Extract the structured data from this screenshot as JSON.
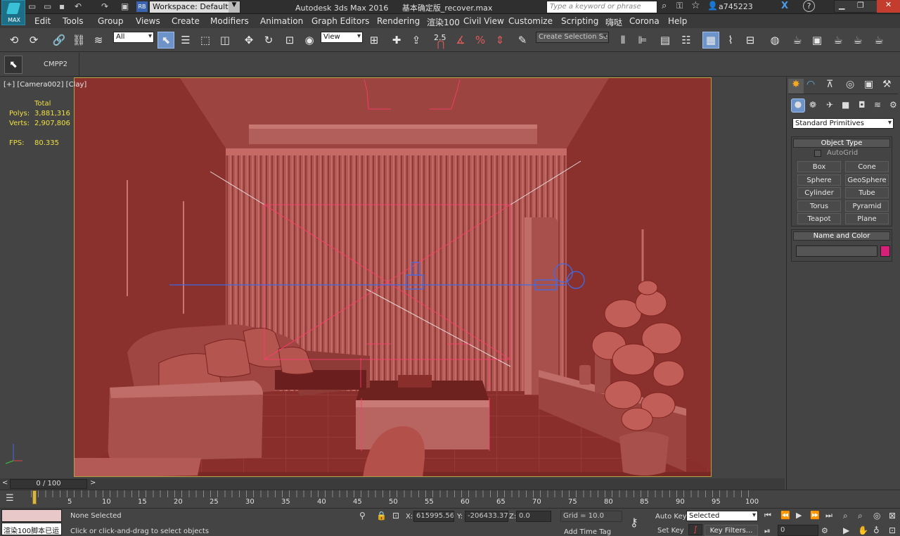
{
  "titlebar": {
    "logo_label": "MAX",
    "workspace_badge": "RB",
    "workspace": "Workspace: Default",
    "app_title": "Autodesk 3ds Max 2016",
    "file_name": "基本确定版_recover.max",
    "search_placeholder": "Type a keyword or phrase",
    "user": "a745223"
  },
  "menubar": {
    "items": [
      "Edit",
      "Tools",
      "Group",
      "Views",
      "Create",
      "Modifiers",
      "Animation",
      "Graph Editors",
      "Rendering",
      "渲染100",
      "Civil View",
      "Customize",
      "Scripting",
      "嗨哒",
      "Corona",
      "Help"
    ]
  },
  "toolbar": {
    "filter": "All",
    "reference_coord": "View",
    "snap_value": "2.5",
    "selection_set_placeholder": "Create Selection Se"
  },
  "ribbon": {
    "tab": "CMPP2"
  },
  "viewport": {
    "label": "[+] [Camera002] [Clay]",
    "stats": {
      "total_label": "Total",
      "polys_label": "Polys:",
      "polys_value": "3,881,316",
      "verts_label": "Verts:",
      "verts_value": "2,907,806",
      "fps_label": "FPS:",
      "fps_value": "80.335"
    },
    "colors": {
      "clay": "#a54844",
      "frame": "#b8a040",
      "selection": "#f05080"
    }
  },
  "command_panel": {
    "category": "Standard Primitives",
    "object_type_header": "Object Type",
    "autogrid": "AutoGrid",
    "primitives": [
      "Box",
      "Cone",
      "Sphere",
      "GeoSphere",
      "Cylinder",
      "Tube",
      "Torus",
      "Pyramid",
      "Teapot",
      "Plane"
    ],
    "name_color_header": "Name and Color",
    "object_color": "#d8207a"
  },
  "timeline": {
    "frame_label": "0 / 100",
    "ticks": [
      "5",
      "10",
      "15",
      "20",
      "25",
      "30",
      "35",
      "40",
      "45",
      "50",
      "55",
      "60",
      "65",
      "70",
      "75",
      "80",
      "85",
      "90",
      "95",
      "100"
    ]
  },
  "status": {
    "maxscript_text": "渲染100脚本已运",
    "selection": "None Selected",
    "prompt": "Click or click-and-drag to select objects",
    "x_label": "X:",
    "x_value": "615995.56",
    "y_label": "Y:",
    "y_value": "-206433.37",
    "z_label": "Z:",
    "z_value": "0.0",
    "grid": "Grid = 10.0",
    "add_time_tag": "Add Time Tag",
    "auto_key": "Auto Key",
    "set_key": "Set Key",
    "key_mode": "Selected",
    "key_filters": "Key Filters...",
    "current_frame": "0"
  }
}
